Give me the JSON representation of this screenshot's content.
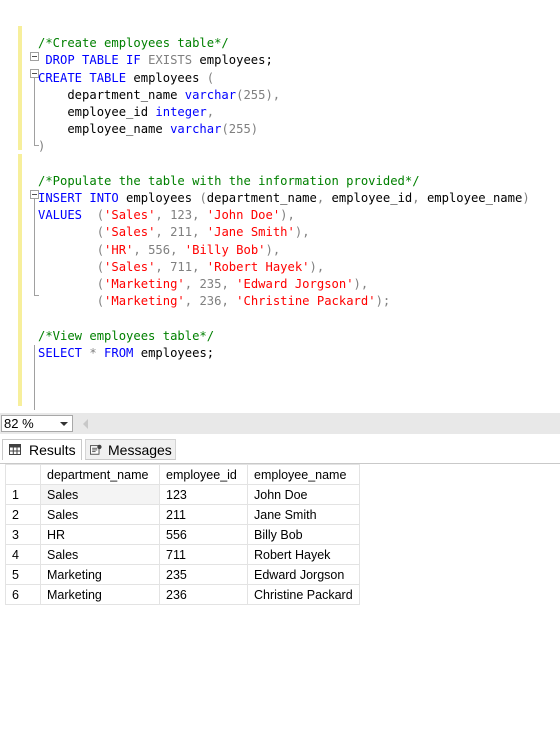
{
  "editor": {
    "lines": [
      [],
      [
        {
          "t": "/*Create employees table*/",
          "c": "cm"
        }
      ],
      [
        {
          "t": " DROP TABLE IF ",
          "c": "kw"
        },
        {
          "t": "EXISTS",
          "c": "gray"
        },
        {
          "t": " employees;",
          "c": "plain"
        }
      ],
      [
        {
          "t": "CREATE TABLE",
          "c": "kw"
        },
        {
          "t": " employees ",
          "c": "plain"
        },
        {
          "t": "(",
          "c": "gray"
        }
      ],
      [
        {
          "t": "    department_name ",
          "c": "plain"
        },
        {
          "t": "varchar",
          "c": "kw"
        },
        {
          "t": "(255),",
          "c": "gray"
        }
      ],
      [
        {
          "t": "    employee_id ",
          "c": "plain"
        },
        {
          "t": "integer",
          "c": "kw"
        },
        {
          "t": ",",
          "c": "gray"
        }
      ],
      [
        {
          "t": "    employee_name ",
          "c": "plain"
        },
        {
          "t": "varchar",
          "c": "kw"
        },
        {
          "t": "(255)",
          "c": "gray"
        }
      ],
      [
        {
          "t": ")",
          "c": "gray"
        }
      ],
      [],
      [
        {
          "t": "/*Populate the table with the information provided*/",
          "c": "cm"
        }
      ],
      [
        {
          "t": "INSERT INTO",
          "c": "kw"
        },
        {
          "t": " employees ",
          "c": "plain"
        },
        {
          "t": "(",
          "c": "gray"
        },
        {
          "t": "department_name",
          "c": "plain"
        },
        {
          "t": ", ",
          "c": "gray"
        },
        {
          "t": "employee_id",
          "c": "plain"
        },
        {
          "t": ", ",
          "c": "gray"
        },
        {
          "t": "employee_name",
          "c": "plain"
        },
        {
          "t": ")",
          "c": "gray"
        }
      ],
      [
        {
          "t": "VALUES",
          "c": "kw"
        },
        {
          "t": "  (",
          "c": "gray"
        },
        {
          "t": "'Sales'",
          "c": "str"
        },
        {
          "t": ", 123, ",
          "c": "gray"
        },
        {
          "t": "'John Doe'",
          "c": "str"
        },
        {
          "t": "),",
          "c": "gray"
        }
      ],
      [
        {
          "t": "        (",
          "c": "gray"
        },
        {
          "t": "'Sales'",
          "c": "str"
        },
        {
          "t": ", 211, ",
          "c": "gray"
        },
        {
          "t": "'Jane Smith'",
          "c": "str"
        },
        {
          "t": "),",
          "c": "gray"
        }
      ],
      [
        {
          "t": "        (",
          "c": "gray"
        },
        {
          "t": "'HR'",
          "c": "str"
        },
        {
          "t": ", 556, ",
          "c": "gray"
        },
        {
          "t": "'Billy Bob'",
          "c": "str"
        },
        {
          "t": "),",
          "c": "gray"
        }
      ],
      [
        {
          "t": "        (",
          "c": "gray"
        },
        {
          "t": "'Sales'",
          "c": "str"
        },
        {
          "t": ", 711, ",
          "c": "gray"
        },
        {
          "t": "'Robert Hayek'",
          "c": "str"
        },
        {
          "t": "),",
          "c": "gray"
        }
      ],
      [
        {
          "t": "        (",
          "c": "gray"
        },
        {
          "t": "'Marketing'",
          "c": "str"
        },
        {
          "t": ", 235, ",
          "c": "gray"
        },
        {
          "t": "'Edward Jorgson'",
          "c": "str"
        },
        {
          "t": "),",
          "c": "gray"
        }
      ],
      [
        {
          "t": "        (",
          "c": "gray"
        },
        {
          "t": "'Marketing'",
          "c": "str"
        },
        {
          "t": ", 236, ",
          "c": "gray"
        },
        {
          "t": "'Christine Packard'",
          "c": "str"
        },
        {
          "t": ");",
          "c": "gray"
        }
      ],
      [],
      [
        {
          "t": "/*View employees table*/",
          "c": "cm"
        }
      ],
      [
        {
          "t": "SELECT",
          "c": "kw"
        },
        {
          "t": " * ",
          "c": "gray"
        },
        {
          "t": "FROM",
          "c": "kw"
        },
        {
          "t": " employees;",
          "c": "plain"
        }
      ]
    ]
  },
  "status": {
    "zoom": "82 %"
  },
  "tabs": {
    "results": "Results",
    "messages": "Messages"
  },
  "grid": {
    "columns": [
      "department_name",
      "employee_id",
      "employee_name"
    ],
    "rows": [
      {
        "num": "1",
        "cells": [
          "Sales",
          "123",
          "John Doe"
        ]
      },
      {
        "num": "2",
        "cells": [
          "Sales",
          "211",
          "Jane Smith"
        ]
      },
      {
        "num": "3",
        "cells": [
          "HR",
          "556",
          "Billy Bob"
        ]
      },
      {
        "num": "4",
        "cells": [
          "Sales",
          "711",
          "Robert Hayek"
        ]
      },
      {
        "num": "5",
        "cells": [
          "Marketing",
          "235",
          "Edward Jorgson"
        ]
      },
      {
        "num": "6",
        "cells": [
          "Marketing",
          "236",
          "Christine Packard"
        ]
      }
    ]
  }
}
